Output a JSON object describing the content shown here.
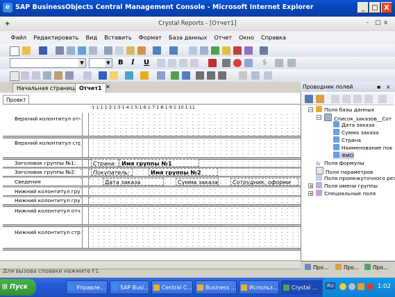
{
  "ie": {
    "title": "SAP BusinessObjects Central Management Console - Microsoft Internet Explorer",
    "min": "_",
    "max": "□",
    "close": "X"
  },
  "cr": {
    "title": "Crystal Reports - [Отчет1]",
    "min": "-",
    "restore": "□",
    "close": "x"
  },
  "menu": [
    "Файл",
    "Редактировать",
    "Вид",
    "Вставить",
    "Формат",
    "База данных",
    "Отчет",
    "Окно",
    "Справка"
  ],
  "toolbar": {
    "bold": "B",
    "italic": "I",
    "underline": "U",
    "currency": "$"
  },
  "tabs": {
    "start": "Начальная страница",
    "report": "Отчет1",
    "close": "✕",
    "project": "Проект"
  },
  "ruler": "·1·1·1·1·2·1·3·1·4·1·5·1·6·1·7·1·8·1·9·1·10·1·11",
  "sections": [
    {
      "label": "Верхний колонтитул отчет"
    },
    {
      "label": "Верхний колонтитул стран"
    },
    {
      "label": "Заголовок группы №1:"
    },
    {
      "label": "Заголовок группы №2:"
    },
    {
      "label": "Сведения"
    },
    {
      "label": "Нижний колонтитул групп"
    },
    {
      "label": "Нижний колонтитул групп"
    },
    {
      "label": "Нижний колонтитул отчет"
    },
    {
      "label": "Нижний колонтитул стран"
    }
  ],
  "fields": {
    "g1_label": "Страна:",
    "g1_value": "Имя группы №1",
    "g2_label": "Покупатель:",
    "g2_value": "Имя группы №2",
    "d1": "Дата заказа",
    "d2": "Сумма заказа",
    "d3": "Сотрудник, оформи"
  },
  "explorer": {
    "title": "Проводник полей",
    "pin": "▪",
    "close": "x",
    "tree": [
      {
        "label": "Поля базы данных",
        "icon": "database-icon"
      },
      {
        "label": "Список_заказов__Сот",
        "icon": "table-icon"
      },
      {
        "label": "Дата заказа",
        "icon": "field-icon"
      },
      {
        "label": "Сумма заказа",
        "icon": "field-icon"
      },
      {
        "label": "Страна",
        "icon": "field-icon"
      },
      {
        "label": "Наименование пок",
        "icon": "field-icon"
      },
      {
        "label": "ФИО",
        "icon": "field-icon"
      },
      {
        "label": "Поля формулы",
        "icon": "formula-icon"
      },
      {
        "label": "Поля параметров",
        "icon": "parameter-icon"
      },
      {
        "label": "Поля промежуточного рез",
        "icon": "running-total-icon"
      },
      {
        "label": "Поля имени группы",
        "icon": "group-name-icon"
      },
      {
        "label": "Специальные поля",
        "icon": "special-field-icon"
      }
    ],
    "bottom_tabs": [
      "Про...",
      "Про...",
      "Про..."
    ]
  },
  "status": "Для вызова справки нажмите F1",
  "taskbar": {
    "start": "Пуск",
    "tasks": [
      "Управле...",
      "SAP Busi...",
      "Central C...",
      "Business ...",
      "Использ...",
      "Crystal ..."
    ],
    "lang": "RU",
    "time": "1:02"
  },
  "colors": {
    "ie_blue": "#0a3ea6",
    "start_green": "#2f8f2f",
    "tray": "#0f7fd2"
  }
}
